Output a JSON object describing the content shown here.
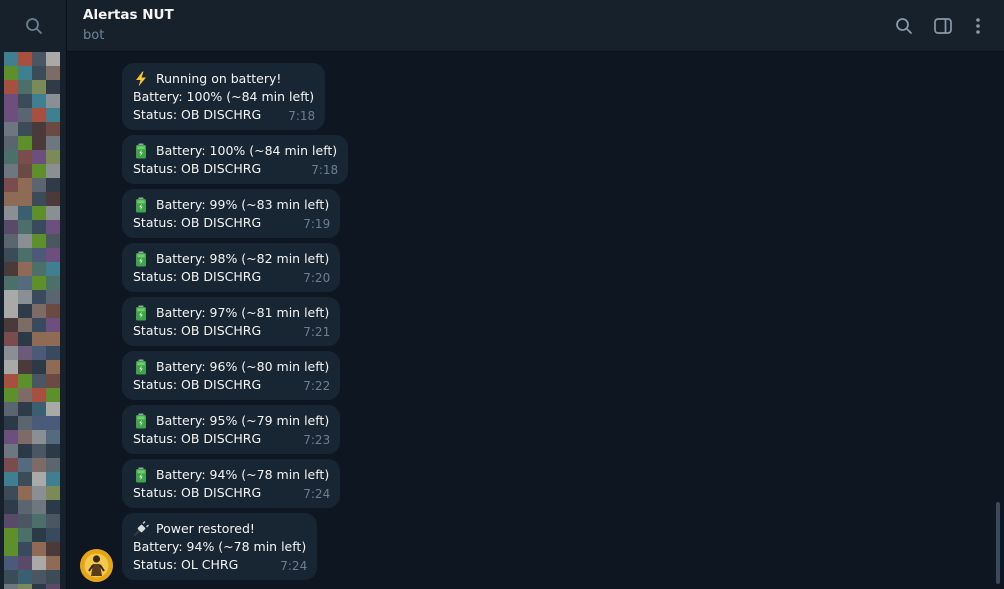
{
  "header": {
    "title": "Alertas NUT",
    "subtitle": "bot"
  },
  "icons": {
    "sidebar_search": "search-icon",
    "header_search": "search-icon",
    "header_panel": "side-panel-icon",
    "header_menu": "more-vertical-icon"
  },
  "colors": {
    "background": "#0e1621",
    "panel": "#17212b",
    "bubble": "#182533",
    "time": "#6d7f8f",
    "subtitle": "#708499"
  },
  "messages": [
    {
      "icon": "lightning-icon",
      "lines": [
        "Running on battery!",
        "Battery: 100% (~84 min left)",
        "Status: OB DISCHRG"
      ],
      "time": "7:18"
    },
    {
      "icon": "battery-icon",
      "lines": [
        "Battery: 100% (~84 min left)",
        "Status: OB DISCHRG"
      ],
      "time": "7:18"
    },
    {
      "icon": "battery-icon",
      "lines": [
        "Battery: 99% (~83 min left)",
        "Status: OB DISCHRG"
      ],
      "time": "7:19"
    },
    {
      "icon": "battery-icon",
      "lines": [
        "Battery: 98% (~82 min left)",
        "Status: OB DISCHRG"
      ],
      "time": "7:20"
    },
    {
      "icon": "battery-icon",
      "lines": [
        "Battery: 97% (~81 min left)",
        "Status: OB DISCHRG"
      ],
      "time": "7:21"
    },
    {
      "icon": "battery-icon",
      "lines": [
        "Battery: 96% (~80 min left)",
        "Status: OB DISCHRG"
      ],
      "time": "7:22"
    },
    {
      "icon": "battery-icon",
      "lines": [
        "Battery: 95% (~79 min left)",
        "Status: OB DISCHRG"
      ],
      "time": "7:23"
    },
    {
      "icon": "battery-icon",
      "lines": [
        "Battery: 94% (~78 min left)",
        "Status: OB DISCHRG"
      ],
      "time": "7:24"
    },
    {
      "icon": "plug-icon",
      "lines": [
        "Power restored!",
        "Battery: 94% (~78 min left)",
        "Status: OL CHRG"
      ],
      "time": "7:24"
    }
  ]
}
